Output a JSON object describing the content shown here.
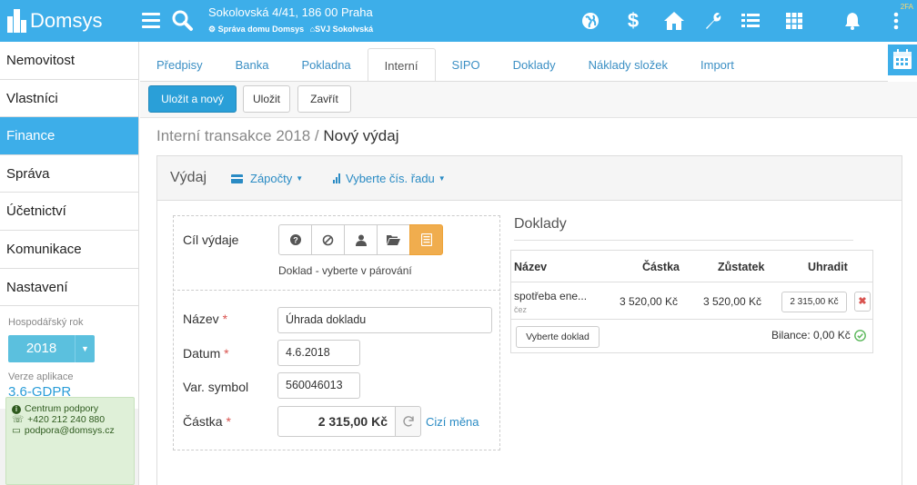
{
  "app": {
    "logo_text": "Domsys",
    "badge": "2FA"
  },
  "header": {
    "address": "Sokolovská 4/41, 186 00 Praha",
    "org1": "Správa domu Domsys",
    "org2": "SVJ Sokolvská"
  },
  "topicons": [
    "globe-icon",
    "dollar-icon",
    "home-icon",
    "wrench-icon",
    "list-icon",
    "grid-icon",
    "bell-icon",
    "more-icon"
  ],
  "sidebar": {
    "items": [
      {
        "label": "Nemovitost"
      },
      {
        "label": "Vlastníci"
      },
      {
        "label": "Finance"
      },
      {
        "label": "Správa"
      },
      {
        "label": "Účetnictví"
      },
      {
        "label": "Komunikace"
      },
      {
        "label": "Nastavení"
      }
    ],
    "active_index": 2,
    "fiscal_year_label": "Hospodářský rok",
    "fiscal_year": "2018",
    "version_label": "Verze aplikace",
    "version": "3.6-GDPR",
    "support": {
      "title": "Centrum podpory",
      "phone": "+420 212 240 880",
      "email": "podpora@domsys.cz"
    }
  },
  "tabs": [
    {
      "label": "Předpisy"
    },
    {
      "label": "Banka"
    },
    {
      "label": "Pokladna"
    },
    {
      "label": "Interní"
    },
    {
      "label": "SIPO"
    },
    {
      "label": "Doklady"
    },
    {
      "label": "Náklady složek"
    },
    {
      "label": "Import"
    }
  ],
  "active_tab": 3,
  "actions": {
    "save_new": "Uložit a nový",
    "save": "Uložit",
    "close": "Zavřít"
  },
  "breadcrumb": {
    "parent": "Interní transakce 2018",
    "sep": " / ",
    "current": "Nový výdaj"
  },
  "panel": {
    "title": "Výdaj",
    "dd1": "Zápočty",
    "dd2": "Vyberte čís. řadu"
  },
  "form": {
    "target_label": "Cíl výdaje",
    "target_hint": "Doklad - vyberte v párování",
    "name_label": "Název",
    "name_value": "Úhrada dokladu",
    "date_label": "Datum",
    "date_value": "4.6.2018",
    "vs_label": "Var. symbol",
    "vs_value": "560046013",
    "amount_label": "Částka",
    "amount_value": "2 315,00 Kč",
    "foreign_link": "Cizí měna",
    "required_mark": "*"
  },
  "doklady": {
    "title": "Doklady",
    "columns": [
      "Název",
      "Částka",
      "Zůstatek",
      "Uhradit"
    ],
    "rows": [
      {
        "name": "spotřeba ene...",
        "sub": "čez",
        "amount": "3 520,00 Kč",
        "balance": "3 520,00 Kč",
        "pay": "2 315,00 Kč"
      }
    ],
    "select_button": "Vyberte doklad",
    "balance_text": "Bilance: 0,00 Kč"
  },
  "colors": {
    "brand": "#3daee9",
    "primary": "#2a9fd8",
    "warning": "#f0ad4e",
    "success": "#5cb85c",
    "danger": "#d9534f"
  }
}
